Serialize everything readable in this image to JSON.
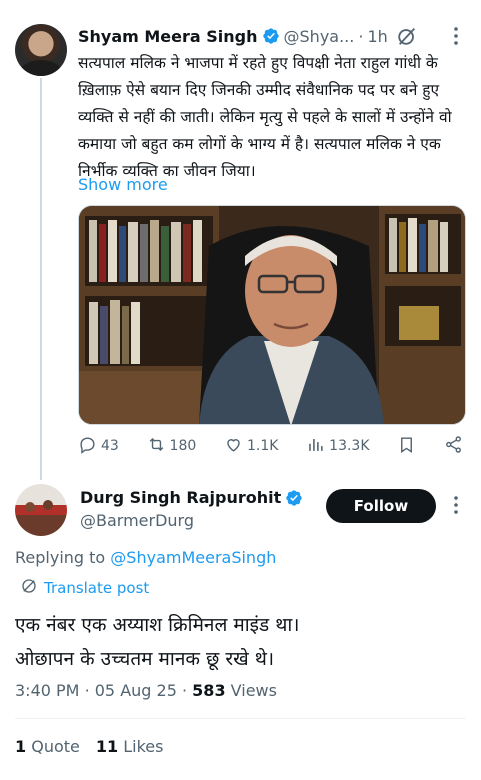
{
  "original_tweet": {
    "author_name": "Shyam Meera Singh",
    "handle": "@Shya...",
    "separator": "·",
    "time": "1h",
    "text": "सत्यपाल मलिक ने भाजपा में रहते हुए विपक्षी नेता राहुल गांधी के ख़िलाफ़ ऐसे बयान दिए जिनकी उम्मीद संवैधानिक पद पर बने हुए व्यक्ति से नहीं की जाती। लेकिन मृत्यु से पहले के सालों में उन्होंने वो कमाया जो बहुत कम लोगों के भाग्य में है। सत्यपाल मलिक ने एक निर्भीक व्यक्ति का जीवन जिया।",
    "show_more": "Show more",
    "actions": {
      "replies": "43",
      "reposts": "180",
      "likes": "1.1K",
      "views": "13.3K"
    }
  },
  "reply": {
    "author_name": "Durg Singh Rajpurohit",
    "handle": "@BarmerDurg",
    "follow_label": "Follow",
    "replying_prefix": "Replying to",
    "replying_to": "@ShyamMeeraSingh",
    "translate_label": "Translate post",
    "text_line1": "एक नंबर एक अय्याश क्रिमिनल माइंड था।",
    "text_line2": "ओछापन के उच्चतम मानक छू रखे थे।",
    "time": "3:40 PM",
    "separator": "·",
    "date": "05 Aug 25",
    "views_count": "583",
    "views_label": "Views",
    "quote_count": "1",
    "quote_label": "Quote",
    "like_count": "11",
    "like_label": "Likes"
  },
  "colors": {
    "accent": "#1d9bf0",
    "text": "#0f1419",
    "secondary": "#536471",
    "follow_bg": "#0f1419"
  }
}
